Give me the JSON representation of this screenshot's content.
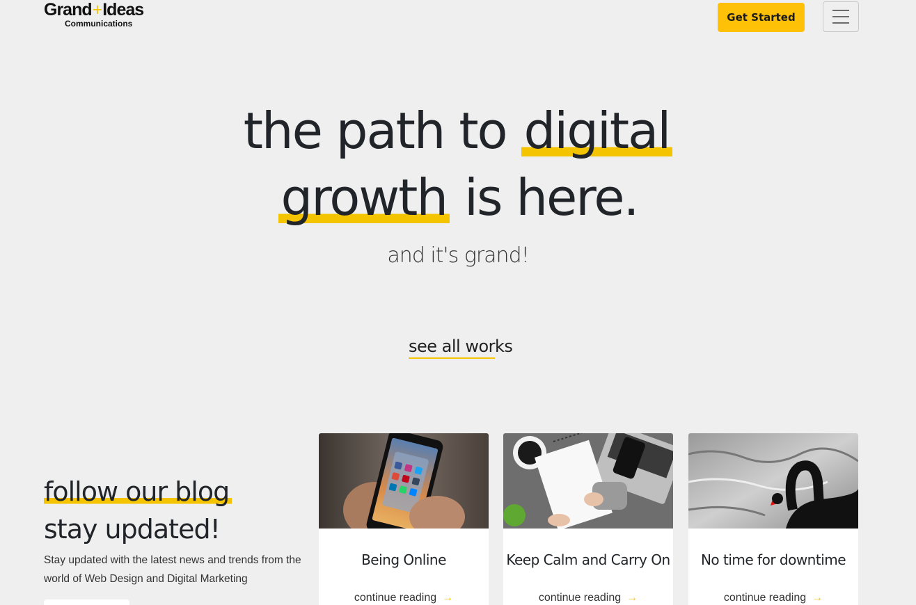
{
  "header": {
    "logo_main_left": "Grand",
    "logo_plus": "+",
    "logo_main_right": "Ideas",
    "logo_sub": "Communications",
    "cta_label": "Get Started",
    "menu_icon": "hamburger-icon"
  },
  "hero": {
    "line1_plain": "the path to",
    "line1_highlight": "digital",
    "line2_highlight": "growth",
    "line2_plain": "is here.",
    "tagline": "and it's grand!",
    "see_all": "see all works"
  },
  "blog": {
    "heading_highlight": "follow our blog",
    "heading_line2": "stay updated!",
    "description": "Stay updated with the latest news and trends from the world of Web Design and Digital Marketing",
    "cards": [
      {
        "title": "Being Online",
        "link": "continue reading",
        "arrow": "→"
      },
      {
        "title": "Keep Calm and Carry On",
        "link": "continue reading",
        "arrow": "→"
      },
      {
        "title": "No time for downtime",
        "link": "continue reading",
        "arrow": "→"
      }
    ]
  },
  "colors": {
    "accent": "#f5c400",
    "button": "#ffc107",
    "background": "#efefef",
    "text": "#212529"
  }
}
